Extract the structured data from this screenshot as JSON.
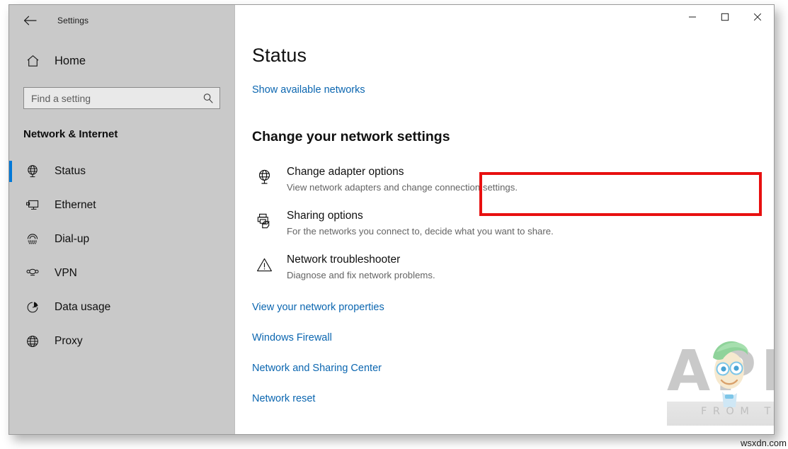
{
  "window": {
    "app_title": "Settings",
    "back_icon": "back-arrow-icon",
    "controls": {
      "minimize_label": "Minimize",
      "maximize_label": "Maximize",
      "close_label": "Close"
    }
  },
  "sidebar": {
    "home_label": "Home",
    "home_icon": "home-icon",
    "search": {
      "placeholder": "Find a setting",
      "value": "",
      "icon": "search-icon"
    },
    "category": "Network & Internet",
    "items": [
      {
        "label": "Status",
        "icon": "globe-status-icon",
        "selected": true
      },
      {
        "label": "Ethernet",
        "icon": "ethernet-icon",
        "selected": false
      },
      {
        "label": "Dial-up",
        "icon": "dialup-icon",
        "selected": false
      },
      {
        "label": "VPN",
        "icon": "vpn-icon",
        "selected": false
      },
      {
        "label": "Data usage",
        "icon": "pie-chart-icon",
        "selected": false
      },
      {
        "label": "Proxy",
        "icon": "globe-icon",
        "selected": false
      }
    ]
  },
  "main": {
    "title": "Status",
    "show_networks_link": "Show available networks",
    "section_heading": "Change your network settings",
    "settings": [
      {
        "title": "Change adapter options",
        "desc": "View network adapters and change connection settings.",
        "icon": "network-adapter-icon",
        "highlighted": true
      },
      {
        "title": "Sharing options",
        "desc": "For the networks you connect to, decide what you want to share.",
        "icon": "sharing-icon",
        "highlighted": false
      },
      {
        "title": "Network troubleshooter",
        "desc": "Diagnose and fix network problems.",
        "icon": "warning-triangle-icon",
        "highlighted": false
      }
    ],
    "links": [
      "View your network properties",
      "Windows Firewall",
      "Network and Sharing Center",
      "Network reset"
    ]
  },
  "watermark": {
    "brand": "APPUALS",
    "tagline": "FROM THE EXPERTS!",
    "site_tag": "wsxdn.com"
  },
  "colors": {
    "accent": "#0078d7",
    "link": "#0b66b0",
    "highlight": "#e81010",
    "text": "#101010",
    "muted": "#646464"
  }
}
